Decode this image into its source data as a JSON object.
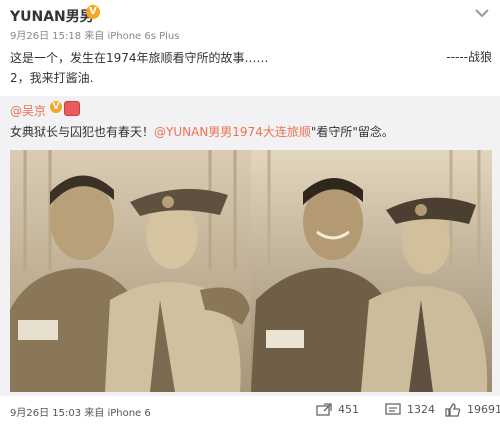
{
  "post": {
    "author": "YUNAN男男",
    "verified_badge": "V",
    "meta": "9月26日 15:18 来自 iPhone 6s Plus",
    "text": "这是一个，发生在1974年旅顺看守所的故事……\n2，我来打酱油.",
    "signature": "-----战狼"
  },
  "repost": {
    "author": "@吴京",
    "verified_badge": "V",
    "text_prefix": "女典狱长与囚犯也有春天！",
    "mention": "@YUNAN男男1974大连旅顺",
    "text_suffix": "\"看守所\"留念。",
    "photos": [
      {
        "name": "photo-left-couple"
      },
      {
        "name": "photo-right-couple"
      }
    ]
  },
  "footer": {
    "time": "9月26日 15:03 来自 iPhone 6",
    "repost_count": "451",
    "comment_count": "1324",
    "like_count": "19691"
  },
  "icons": {
    "more": "chevron-down-icon",
    "repost": "repost-icon",
    "comment": "comment-icon",
    "like": "thumbs-up-icon"
  },
  "colors": {
    "accent": "#eb7350",
    "badge": "#f5a623",
    "repost_bg": "#f2f2f5"
  }
}
